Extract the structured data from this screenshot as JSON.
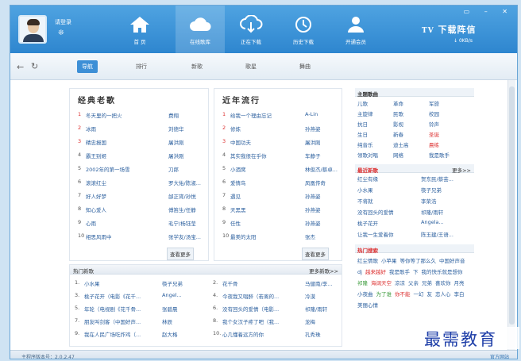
{
  "header": {
    "login_text": "请登录",
    "nav": [
      {
        "label": "首  页",
        "icon": "home-icon"
      },
      {
        "label": "在线歌库",
        "icon": "cloud-icon"
      },
      {
        "label": "正在下载",
        "icon": "download-cloud-icon"
      },
      {
        "label": "历史下载",
        "icon": "history-icon"
      },
      {
        "label": "开通会员",
        "icon": "member-icon"
      }
    ],
    "logo_text": "下载阵信",
    "speed": "0KB/s",
    "window_controls": "▭ – ✕"
  },
  "toolbar": {
    "tabs": [
      "导航",
      "排行",
      "新歌",
      "歌星",
      "舞曲"
    ]
  },
  "classic": {
    "title": "经典老歌",
    "more": "查看更多",
    "items": [
      {
        "n": "1",
        "title": "冬天里的一把火",
        "artist": "费翔"
      },
      {
        "n": "2",
        "title": "冰雨",
        "artist": "刘德华"
      },
      {
        "n": "3",
        "title": "精忠报国",
        "artist": "屠洪刚"
      },
      {
        "n": "4",
        "title": "霸王别姬",
        "artist": "屠洪刚"
      },
      {
        "n": "5",
        "title": "2002年的第一场雪",
        "artist": "刀郎"
      },
      {
        "n": "6",
        "title": "滚滚红尘",
        "artist": "罗大佑/陈淑..."
      },
      {
        "n": "7",
        "title": "好人好梦",
        "artist": "邰正宵/孙悦"
      },
      {
        "n": "8",
        "title": "知心爱人",
        "artist": "傅笛生/任静"
      },
      {
        "n": "9",
        "title": "心雨",
        "artist": "毛宁/杨钰莹"
      },
      {
        "n": "10",
        "title": "相思风雨中",
        "artist": "张学友/汤宝..."
      }
    ]
  },
  "recent": {
    "title": "近年流行",
    "more": "查看更多",
    "items": [
      {
        "n": "1",
        "title": "给我一个理由忘记",
        "artist": "A-Lin"
      },
      {
        "n": "2",
        "title": "修炼",
        "artist": "孙燕姿"
      },
      {
        "n": "3",
        "title": "中国功夫",
        "artist": "屠洪刚"
      },
      {
        "n": "4",
        "title": "其实我很在乎你",
        "artist": "车静子"
      },
      {
        "n": "5",
        "title": "小酒窝",
        "artist": "林俊杰/蔡卓..."
      },
      {
        "n": "6",
        "title": "爱情鸟",
        "artist": "凤凰传奇"
      },
      {
        "n": "7",
        "title": "遇见",
        "artist": "孙燕姿"
      },
      {
        "n": "8",
        "title": "天黑黑",
        "artist": "孙燕姿"
      },
      {
        "n": "9",
        "title": "任性",
        "artist": "孙燕姿"
      },
      {
        "n": "10",
        "title": "最美的太阳",
        "artist": "张杰"
      }
    ]
  },
  "hot_new": {
    "title": "热门新歌",
    "more": "更多新歌>>",
    "left": [
      {
        "n": "1.",
        "title": "小水果",
        "artist": "筷子兄弟"
      },
      {
        "n": "3.",
        "title": "桃子花开（电影《花千...",
        "artist": "Angel..."
      },
      {
        "n": "5.",
        "title": "年轮（电视剧《花千骨...",
        "artist": "张碧晨"
      },
      {
        "n": "7.",
        "title": "朋友叫剑客（中国好声...",
        "artist": "林辰"
      },
      {
        "n": "9.",
        "title": "我在人民广场吃炸鸡（...",
        "artist": "赵大格"
      }
    ],
    "right": [
      {
        "n": "2.",
        "title": "花千骨",
        "artist": "马健南/李..."
      },
      {
        "n": "4.",
        "title": "今夜我又唱醉（若离的...",
        "artist": "冷漠"
      },
      {
        "n": "6.",
        "title": "没有回头的爱情（电影...",
        "artist": "祁隆/雨轩"
      },
      {
        "n": "8.",
        "title": "我个女汉子疼了吧（我...",
        "artist": "龙梅"
      },
      {
        "n": "10.",
        "title": "心几懂着远方的你",
        "artist": "孔秀珠"
      }
    ]
  },
  "theme": {
    "title": "主题歌曲",
    "items": [
      {
        "label": "儿歌"
      },
      {
        "label": "革命"
      },
      {
        "label": "军旅"
      },
      {
        "label": "主旋律"
      },
      {
        "label": "民歌"
      },
      {
        "label": "校园"
      },
      {
        "label": "抗日"
      },
      {
        "label": "影视"
      },
      {
        "label": "铃声"
      },
      {
        "label": "生日"
      },
      {
        "label": "新春"
      },
      {
        "label": "圣诞",
        "red": true
      },
      {
        "label": "纯音乐"
      },
      {
        "label": "迪士高"
      },
      {
        "label": "晨练",
        "red": true
      },
      {
        "label": "领歌对唱"
      },
      {
        "label": "网络"
      },
      {
        "label": "我是歌手"
      }
    ]
  },
  "latest": {
    "title": "最近新歌",
    "more": "更多>>",
    "items": [
      {
        "title": "红尘有缘",
        "artist": "贺东民/蔡芸..."
      },
      {
        "title": "小水果",
        "artist": "筷子兄弟"
      },
      {
        "title": "不将就",
        "artist": "李荣浩"
      },
      {
        "title": "没有回头的爱情",
        "artist": "祁隆/雨轩"
      },
      {
        "title": "桃子花开",
        "artist": "Angela..."
      },
      {
        "title": "让我一生爱着你",
        "artist": "陈玉建/王语..."
      }
    ]
  },
  "hot_search": {
    "title": "热门搜索",
    "tags": [
      {
        "t": "红尘情歌"
      },
      {
        "t": "小苹果"
      },
      {
        "t": "等你等了那么久"
      },
      {
        "t": "中国好声音"
      },
      {
        "t": "dj"
      },
      {
        "t": "越来越好",
        "c": "red"
      },
      {
        "t": "我是歌手"
      },
      {
        "t": "下"
      },
      {
        "t": "我的快乐就是想你"
      },
      {
        "t": "祁隆",
        "c": "grn"
      },
      {
        "t": "海阔天空",
        "c": "red"
      },
      {
        "t": "凉凉"
      },
      {
        "t": "父亲"
      },
      {
        "t": "兄弟"
      },
      {
        "t": "喜欢你"
      },
      {
        "t": "月亮小夜曲"
      },
      {
        "t": "为了谁",
        "c": "grn"
      },
      {
        "t": "你不能",
        "c": "red"
      },
      {
        "t": "一幻"
      },
      {
        "t": "友"
      },
      {
        "t": "恋人心"
      },
      {
        "t": "李白"
      },
      {
        "t": "美丽心情"
      }
    ]
  },
  "status": {
    "version": "主程序版本号：2.0.2.47",
    "site": "官方网站"
  },
  "watermark": "最需教育"
}
